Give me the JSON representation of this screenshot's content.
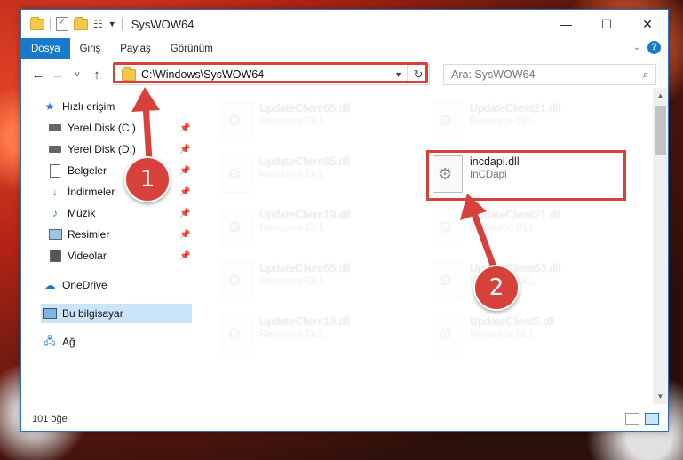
{
  "window": {
    "title": "SysWOW64",
    "controls": {
      "minimize": "—",
      "maximize": "☐",
      "close": "✕"
    }
  },
  "ribbon": {
    "tabs": [
      {
        "label": "Dosya",
        "active": true
      },
      {
        "label": "Giriş"
      },
      {
        "label": "Paylaş"
      },
      {
        "label": "Görünüm"
      }
    ],
    "help": "?"
  },
  "navbar": {
    "back": "←",
    "forward": "→",
    "recent": "˅",
    "up": "↑",
    "address": "C:\\Windows\\SysWOW64",
    "refresh": "↻",
    "search_placeholder": "Ara: SysWOW64",
    "search_icon": "⌕"
  },
  "sidebar": {
    "quick_access": "Hızlı erişim",
    "items": [
      {
        "label": "Yerel Disk (C:)",
        "icon": "drive-icon",
        "pinned": true
      },
      {
        "label": "Yerel Disk (D:)",
        "icon": "drive-icon",
        "pinned": true
      },
      {
        "label": "Belgeler",
        "icon": "documents-icon",
        "pinned": true
      },
      {
        "label": "İndirmeler",
        "icon": "download-icon",
        "pinned": true
      },
      {
        "label": "Müzik",
        "icon": "music-icon",
        "pinned": true
      },
      {
        "label": "Resimler",
        "icon": "pictures-icon",
        "pinned": true
      },
      {
        "label": "Videolar",
        "icon": "videos-icon",
        "pinned": true
      }
    ],
    "onedrive": "OneDrive",
    "this_pc": "Bu bilgisayar",
    "network": "Ağ"
  },
  "files": [
    {
      "name": "UpdateClient65.dll",
      "desc": "Resource DLL",
      "faded": true
    },
    {
      "name": "UpdateClient21.dll",
      "desc": "Resource DLL",
      "faded": true
    },
    {
      "name": "UpdateClient65.dll",
      "desc": "Resource DLL",
      "faded": true
    },
    {
      "name": "incdapi.dll",
      "desc": "InCDapi",
      "faded": false
    },
    {
      "name": "UpdateClient19.dll",
      "desc": "Resource DLL",
      "faded": true
    },
    {
      "name": "UpdateClient21.dll",
      "desc": "Resource DLL",
      "faded": true
    },
    {
      "name": "UpdateClient65.dll",
      "desc": "Resource DLL",
      "faded": true
    },
    {
      "name": "UpdateClient63.dll",
      "desc": "Resource DLL",
      "faded": true
    },
    {
      "name": "UpdateClient19.dll",
      "desc": "Resource DLL",
      "faded": true
    },
    {
      "name": "UpdateClient5.dll",
      "desc": "Resource DLL",
      "faded": true
    }
  ],
  "status": {
    "count": "101 öğe"
  },
  "annotations": {
    "step1": "1",
    "step2": "2",
    "color": "#d8403c"
  }
}
